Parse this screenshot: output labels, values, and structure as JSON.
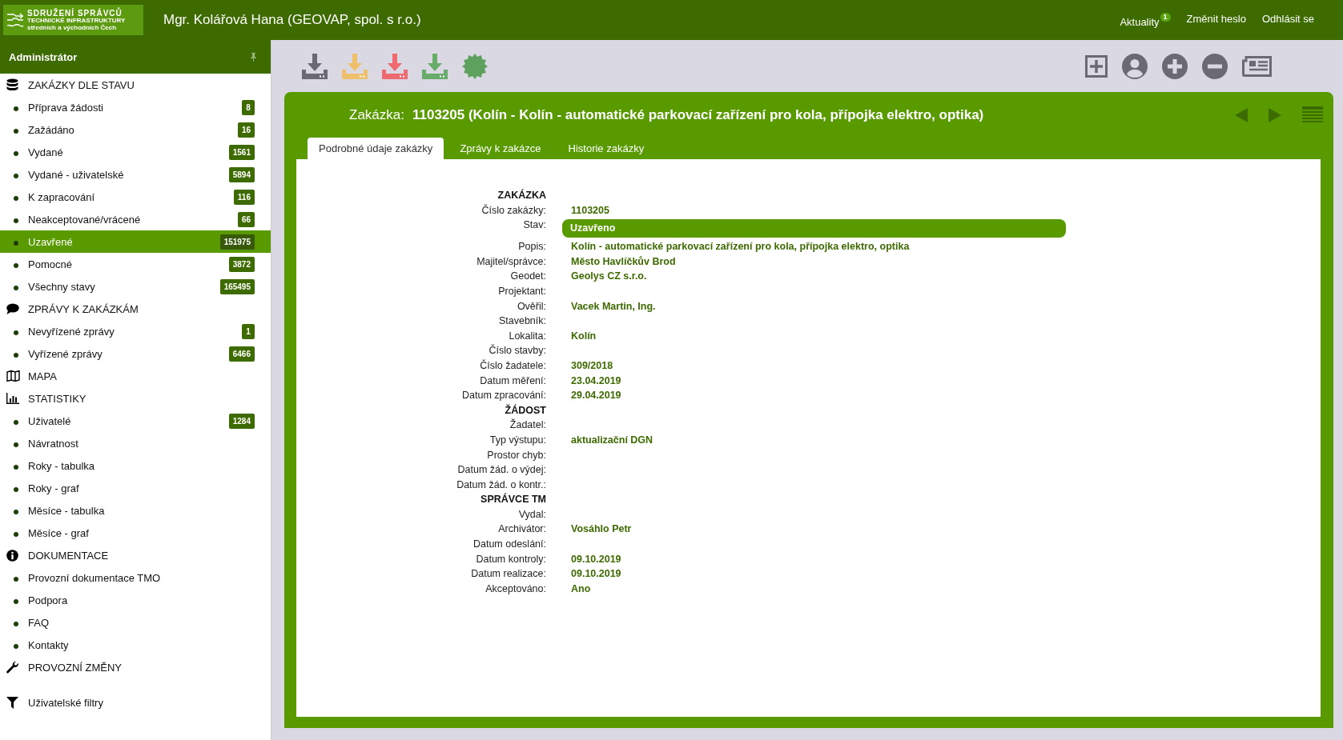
{
  "header": {
    "logo": {
      "line_1": "SDRUŽENÍ SPRÁVCŮ",
      "line_2": "TECHNICKÉ INFRASTRUKTURY",
      "line_3": "středních a východních Čech"
    },
    "user": "Mgr. Kolářová Hana (GEOVAP, spol. s r.o.)",
    "links": [
      {
        "label": "Aktuality",
        "badge": "1"
      },
      {
        "label": "Změnit heslo"
      },
      {
        "label": "Odhlásit se"
      }
    ]
  },
  "sidebar": {
    "role": "Administrátor",
    "sections": [
      {
        "kind": "database",
        "title": "ZAKÁZKY DLE STAVU",
        "items": [
          {
            "label": "Příprava žádosti",
            "count": "8",
            "selected": false
          },
          {
            "label": "Zažádáno",
            "count": "16",
            "selected": false
          },
          {
            "label": "Vydané",
            "count": "1561",
            "selected": false
          },
          {
            "label": "Vydané - uživatelské",
            "count": "5894",
            "selected": false
          },
          {
            "label": "K zapracování",
            "count": "116",
            "selected": false
          },
          {
            "label": "Neakceptované/vrácené",
            "count": "66",
            "selected": false
          },
          {
            "label": "Uzavřené",
            "count": "151975",
            "selected": true
          },
          {
            "label": "Pomocné",
            "count": "3872",
            "selected": false
          },
          {
            "label": "Všechny stavy",
            "count": "165495",
            "selected": false
          }
        ]
      },
      {
        "kind": "chat",
        "title": "ZPRÁVY K ZAKÁZKÁM",
        "items": [
          {
            "label": "Nevyřízené zprávy",
            "count": "1",
            "selected": false
          },
          {
            "label": "Vyřízené zprávy",
            "count": "6466",
            "selected": false
          }
        ]
      },
      {
        "kind": "map",
        "title": "MAPA"
      },
      {
        "kind": "chart",
        "title": "STATISTIKY",
        "items": [
          {
            "label": "Uživatelé",
            "count": "1284",
            "selected": false
          },
          {
            "label": "Návratnost",
            "selected": false
          },
          {
            "label": "Roky - tabulka",
            "selected": false
          },
          {
            "label": "Roky - graf",
            "selected": false
          },
          {
            "label": "Měsíce - tabulka",
            "selected": false
          },
          {
            "label": "Měsíce - graf",
            "selected": false
          }
        ]
      },
      {
        "kind": "info",
        "title": "DOKUMENTACE",
        "items": [
          {
            "label": "Provozní dokumentace TMO",
            "selected": false
          },
          {
            "label": "Podpora",
            "selected": false
          },
          {
            "label": "FAQ",
            "selected": false
          },
          {
            "label": "Kontakty",
            "selected": false
          }
        ]
      },
      {
        "kind": "wrench",
        "title": "PROVOZNÍ ZMĚNY"
      }
    ],
    "filters": {
      "label": "Uživatelské filtry"
    }
  },
  "toolbar": {
    "downloads": [
      {
        "color": "#6b6a72"
      },
      {
        "color": "#efc06c"
      },
      {
        "color": "#ee6a70"
      },
      {
        "color": "#67ac6a"
      }
    ]
  },
  "order": {
    "title_label": "Zakázka:",
    "title": "1103205 (Kolín - Kolín - automatické parkovací zařízení pro kola, přípojka elektro, optika)",
    "tabs": [
      {
        "label": "Podrobné údaje zakázky",
        "selected": true
      },
      {
        "label": "Zprávy k zakázce",
        "selected": false
      },
      {
        "label": "Historie zakázky",
        "selected": false
      }
    ],
    "rows": [
      {
        "kind": "heading",
        "label": "ZAKÁZKA"
      },
      {
        "kind": "field",
        "label": "Číslo zakázky:",
        "value": "1103205"
      },
      {
        "kind": "status",
        "label": "Stav:",
        "value": "Uzavřeno"
      },
      {
        "kind": "field",
        "label": "Popis:",
        "value": "Kolín - automatické parkovací zařízení pro kola, přípojka elektro, optika"
      },
      {
        "kind": "field",
        "label": "Majitel/správce:",
        "value": "Město Havlíčkův Brod"
      },
      {
        "kind": "field",
        "label": "Geodet:",
        "value": "Geolys CZ s.r.o."
      },
      {
        "kind": "field",
        "label": "Projektant:"
      },
      {
        "kind": "field",
        "label": "Ověřil:",
        "value": "Vacek Martin, Ing."
      },
      {
        "kind": "field",
        "label": "Stavebník:"
      },
      {
        "kind": "field",
        "label": "Lokalita:",
        "value": "Kolín"
      },
      {
        "kind": "field",
        "label": "Číslo stavby:"
      },
      {
        "kind": "field",
        "label": "Číslo žadatele:",
        "value": "309/2018"
      },
      {
        "kind": "field",
        "label": "Datum měření:",
        "value": "23.04.2019"
      },
      {
        "kind": "field",
        "label": "Datum zpracování:",
        "value": "29.04.2019"
      },
      {
        "kind": "heading",
        "label": "ŽÁDOST"
      },
      {
        "kind": "field",
        "label": "Žadatel:"
      },
      {
        "kind": "field",
        "label": "Typ výstupu:",
        "value": "aktualizační DGN"
      },
      {
        "kind": "field",
        "label": "Prostor chyb:"
      },
      {
        "kind": "field",
        "label": "Datum žád. o výdej:"
      },
      {
        "kind": "field",
        "label": "Datum žád. o kontr.:"
      },
      {
        "kind": "heading",
        "label": "SPRÁVCE TM"
      },
      {
        "kind": "field",
        "label": "Vydal:"
      },
      {
        "kind": "field",
        "label": "Archivátor:",
        "value": "Vosáhlo Petr"
      },
      {
        "kind": "field",
        "label": "Datum odeslání:"
      },
      {
        "kind": "field",
        "label": "Datum kontroly:",
        "value": "09.10.2019"
      },
      {
        "kind": "field",
        "label": "Datum realizace:",
        "value": "09.10.2019"
      },
      {
        "kind": "field",
        "label": "Akceptováno:",
        "value": "Ano"
      }
    ]
  }
}
